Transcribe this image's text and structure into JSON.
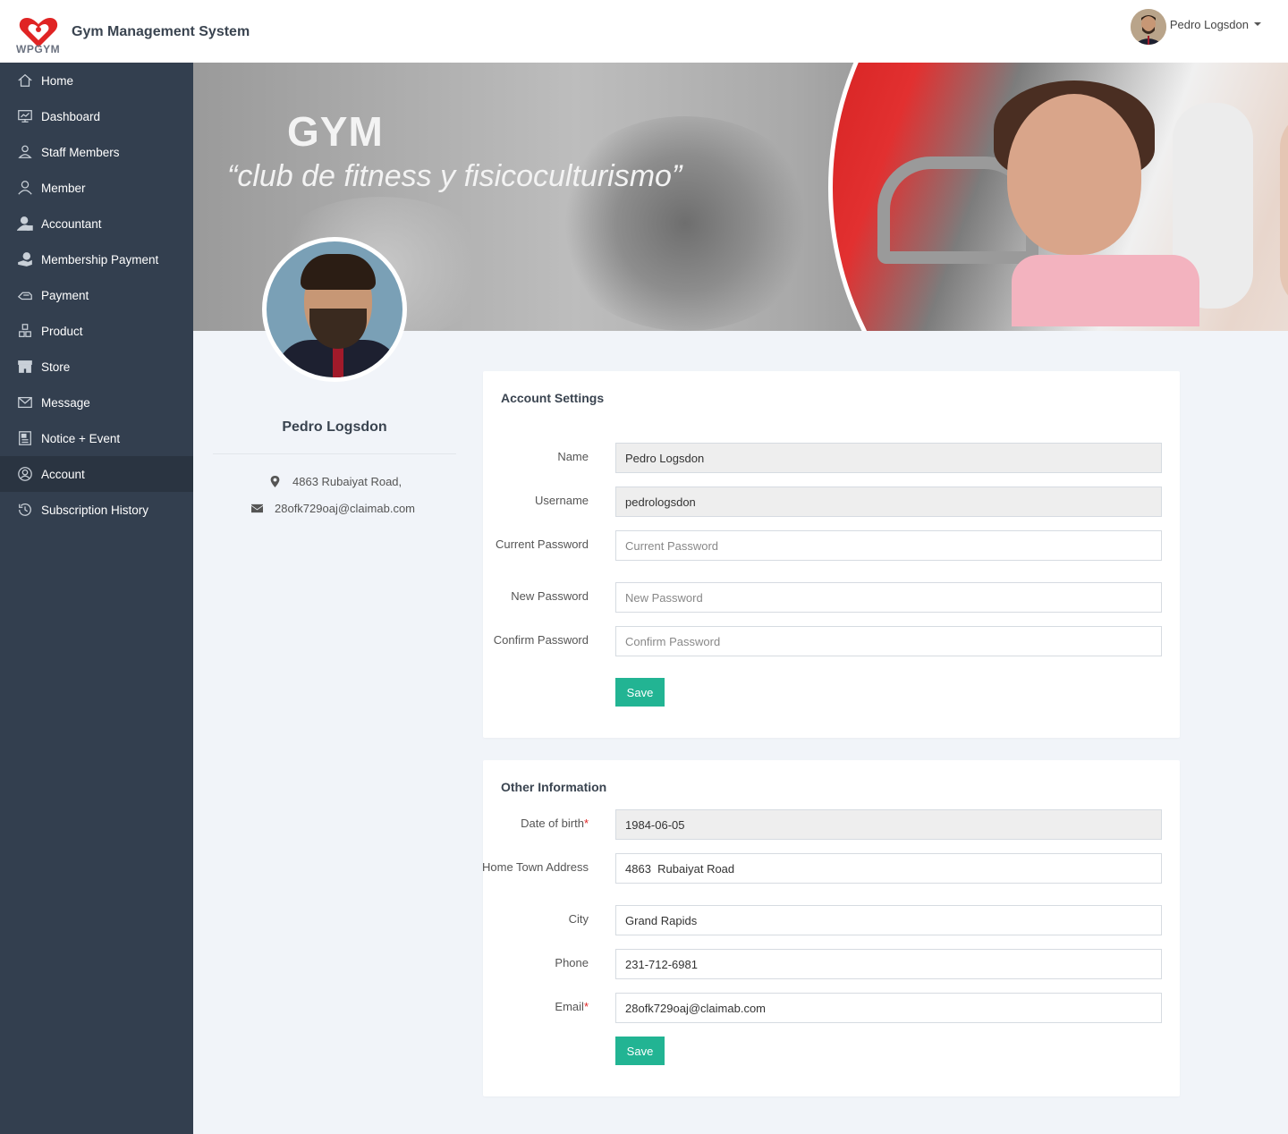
{
  "header": {
    "logo_text": "WPGYM",
    "app_title": "Gym Management System",
    "user_name": "Pedro Logsdon"
  },
  "sidebar": {
    "items": [
      {
        "label": "Home",
        "icon": "home-icon"
      },
      {
        "label": "Dashboard",
        "icon": "dashboard-icon"
      },
      {
        "label": "Staff Members",
        "icon": "staff-icon"
      },
      {
        "label": "Member",
        "icon": "member-icon"
      },
      {
        "label": "Accountant",
        "icon": "accountant-icon"
      },
      {
        "label": "Membership Payment",
        "icon": "membership-payment-icon"
      },
      {
        "label": "Payment",
        "icon": "payment-icon"
      },
      {
        "label": "Product",
        "icon": "product-icon"
      },
      {
        "label": "Store",
        "icon": "store-icon"
      },
      {
        "label": "Message",
        "icon": "message-icon"
      },
      {
        "label": "Notice + Event",
        "icon": "notice-icon"
      },
      {
        "label": "Account",
        "icon": "account-icon",
        "active": true
      },
      {
        "label": "Subscription History",
        "icon": "history-icon"
      }
    ]
  },
  "banner": {
    "title": "GYM",
    "tagline": "“club de fitness y fisicoculturismo”"
  },
  "profile": {
    "name": "Pedro Logsdon",
    "address": "4863 Rubaiyat Road,",
    "email": "28ofk729oaj@claimab.com"
  },
  "account_settings": {
    "title": "Account Settings",
    "name_label": "Name",
    "name_value": "Pedro Logsdon",
    "username_label": "Username",
    "username_value": "pedrologsdon",
    "current_password_label": "Current Password",
    "current_password_placeholder": "Current Password",
    "new_password_label": "New Password",
    "new_password_placeholder": "New Password",
    "confirm_password_label": "Confirm Password",
    "confirm_password_placeholder": "Confirm Password",
    "save_label": "Save"
  },
  "other_information": {
    "title": "Other Information",
    "dob_label": "Date of birth",
    "dob_value": "1984-06-05",
    "address_label": "Home Town Address",
    "address_value": "4863  Rubaiyat Road",
    "city_label": "City",
    "city_value": "Grand Rapids",
    "phone_label": "Phone",
    "phone_value": "231-712-6981",
    "email_label": "Email",
    "email_value": "28ofk729oaj@claimab.com",
    "required_mark": "*",
    "save_label": "Save"
  },
  "colors": {
    "sidebar_bg": "#333f4f",
    "sidebar_active": "#2a3441",
    "accent_button": "#22b493",
    "logo_red": "#e02424",
    "page_bg": "#f1f4f9"
  }
}
